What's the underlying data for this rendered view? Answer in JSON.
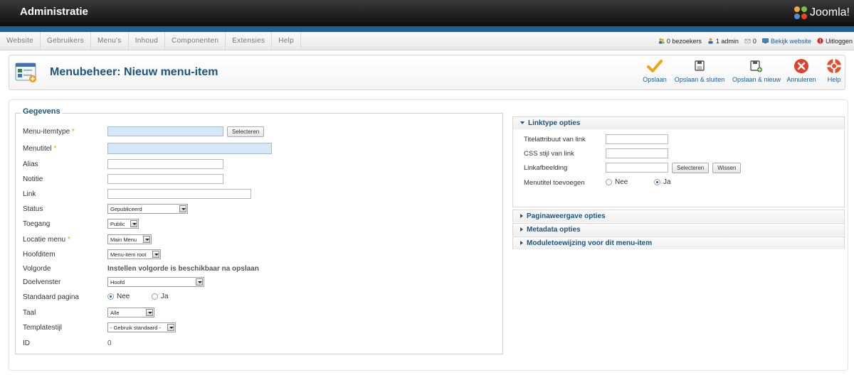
{
  "header": {
    "title": "Administratie",
    "logo_text": "Joomla!"
  },
  "menubar": {
    "items": [
      "Website",
      "Gebruikers",
      "Menu's",
      "Inhoud",
      "Componenten",
      "Extensies",
      "Help"
    ],
    "status": {
      "visitors": "0 bezoekers",
      "admins": "1 admin",
      "messages": "0",
      "view_site": "Bekijk website",
      "logout": "Uitloggen"
    }
  },
  "toolbar": {
    "title": "Menubeheer: Nieuw menu-item",
    "buttons": {
      "save": "Opslaan",
      "save_close": "Opslaan & sluiten",
      "save_new": "Opslaan & nieuw",
      "cancel": "Annuleren",
      "help": "Help"
    }
  },
  "form": {
    "legend": "Gegevens",
    "required_mark": "*",
    "fields": {
      "type": {
        "label": "Menu-itemtype",
        "button": "Selecteren"
      },
      "title": {
        "label": "Menutitel"
      },
      "alias": {
        "label": "Alias"
      },
      "note": {
        "label": "Notitie"
      },
      "link": {
        "label": "Link"
      },
      "status": {
        "label": "Status",
        "value": "Gepubliceerd"
      },
      "access": {
        "label": "Toegang",
        "value": "Public"
      },
      "menu": {
        "label": "Locatie menu",
        "value": "Main Menu"
      },
      "parent": {
        "label": "Hoofditem",
        "value": "Menu-item root"
      },
      "ordering": {
        "label": "Volgorde",
        "value": "Instellen volgorde is beschikbaar na opslaan"
      },
      "target": {
        "label": "Doelvenster",
        "value": "Hoofd"
      },
      "home": {
        "label": "Standaard pagina",
        "options": [
          "Nee",
          "Ja"
        ],
        "selected": "Nee"
      },
      "language": {
        "label": "Taal",
        "value": "Alle"
      },
      "template": {
        "label": "Templatestijl",
        "value": "- Gebruik standaard -"
      },
      "id": {
        "label": "ID",
        "value": "0"
      }
    }
  },
  "panels": {
    "link_options": {
      "title": "Linktype opties",
      "title_attr": {
        "label": "Titelattribuut van link"
      },
      "css_style": {
        "label": "CSS stijl van link"
      },
      "image": {
        "label": "Linkafbeelding",
        "select": "Selecteren",
        "clear": "Wissen"
      },
      "add_title": {
        "label": "Menutitel toevoegen",
        "options": [
          "Nee",
          "Ja"
        ],
        "selected": "Ja"
      }
    },
    "page_display": {
      "title": "Paginaweergave opties"
    },
    "metadata": {
      "title": "Metadata opties"
    },
    "module_assignment": {
      "title": "Moduletoewijzing voor dit menu-item"
    }
  },
  "colors": {
    "header_bg": "#1a1a1a",
    "accent_blue": "#1f5f97",
    "title_blue": "#1a5480",
    "required": "#e0a200"
  }
}
